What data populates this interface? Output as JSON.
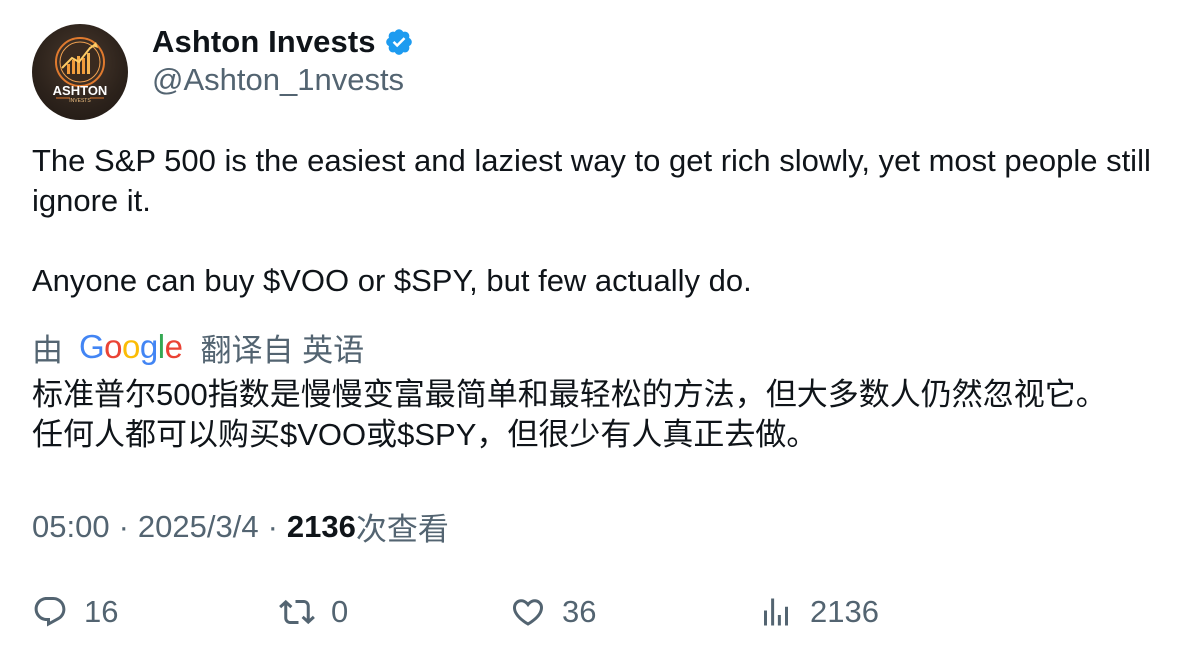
{
  "author": {
    "display_name": "Ashton Invests",
    "handle": "@Ashton_1nvests",
    "avatar_text_main": "ASHTON",
    "avatar_text_sub": "INVESTS",
    "verified": true
  },
  "tweet": {
    "paragraph_1": "The S&P 500 is the easiest and laziest way to get rich slowly, yet most people still ignore it.",
    "paragraph_2": "Anyone can buy $VOO or $SPY, but few actually do."
  },
  "translation": {
    "prefix": "由",
    "google_letters": [
      "G",
      "o",
      "o",
      "g",
      "l",
      "e"
    ],
    "suffix": "翻译自 英语",
    "line_1": "标准普尔500指数是慢慢变富最简单和最轻松的方法，但大多数人仍然忽视它。",
    "line_2": "任何人都可以购买$VOO或$SPY，但很少有人真正去做。"
  },
  "meta": {
    "time": "05:00",
    "separator": "·",
    "date": "2025/3/4",
    "views_count": "2136",
    "views_label": "次查看"
  },
  "actions": {
    "reply_count": "16",
    "retweet_count": "0",
    "like_count": "36",
    "views_count": "2136"
  },
  "colors": {
    "text_primary": "#0f1419",
    "text_secondary": "#536471",
    "verified_blue": "#1d9bf0"
  },
  "icons": {
    "verified": "verified-badge-icon",
    "reply": "reply-icon",
    "retweet": "retweet-icon",
    "like": "heart-icon",
    "views": "views-bar-chart-icon"
  }
}
